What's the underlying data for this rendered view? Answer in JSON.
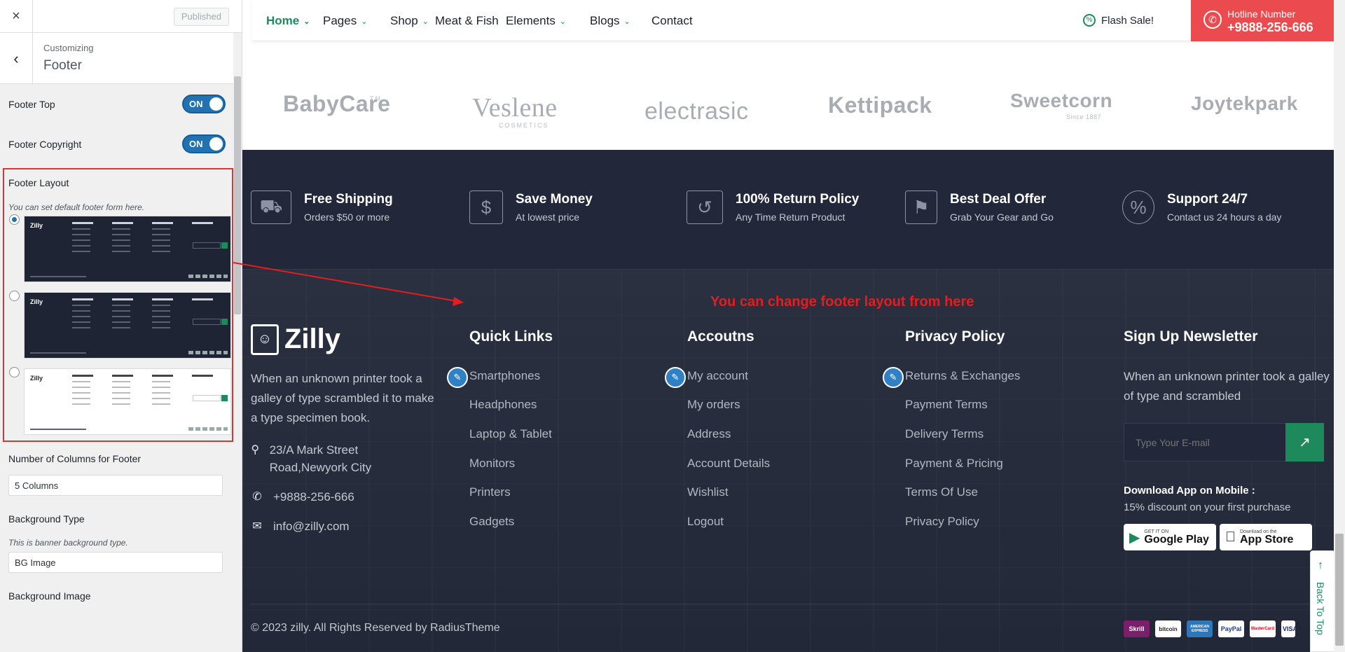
{
  "customizer": {
    "close_icon": "×",
    "published_label": "Published",
    "back_icon": "‹",
    "customizing_label": "Customizing",
    "section_title": "Footer",
    "footer_top_label": "Footer Top",
    "footer_top_toggle": "ON",
    "footer_copyright_label": "Footer Copyright",
    "footer_copyright_toggle": "ON",
    "footer_layout_label": "Footer Layout",
    "footer_layout_desc": "You can set default footer form here.",
    "layout_thumb_logo": "Zilly",
    "columns_label": "Number of Columns for Footer",
    "columns_value": "5 Columns",
    "bg_type_label": "Background Type",
    "bg_type_desc": "This is banner background type.",
    "bg_type_value": "BG Image",
    "bg_image_label": "Background Image"
  },
  "nav": {
    "items": [
      {
        "label": "Home",
        "has_dropdown": true,
        "active": true
      },
      {
        "label": "Pages",
        "has_dropdown": true
      },
      {
        "label": "Shop",
        "has_dropdown": true
      },
      {
        "label": "Meat & Fish",
        "has_dropdown": false
      },
      {
        "label": "Elements",
        "has_dropdown": true
      },
      {
        "label": "Blogs",
        "has_dropdown": true
      },
      {
        "label": "Contact",
        "has_dropdown": false
      }
    ],
    "flash_sale": "Flash Sale!",
    "hotline_label": "Hotline Number",
    "hotline_number": "+9888-256-666"
  },
  "brands": [
    {
      "name": "BabyCare",
      "mark": "TM"
    },
    {
      "name": "Veslene",
      "sub": "COSMETICS"
    },
    {
      "name": "electrasic"
    },
    {
      "name": "Kettipack"
    },
    {
      "name": "Sweetcorn",
      "sub": "Since 1887"
    },
    {
      "name": "Joytekpark"
    }
  ],
  "features": [
    {
      "title": "Free Shipping",
      "sub": "Orders $50 or more",
      "icon": "truck-icon"
    },
    {
      "title": "Save Money",
      "sub": "At lowest price",
      "icon": "money-hand-icon"
    },
    {
      "title": "100% Return Policy",
      "sub": "Any Time Return Product",
      "icon": "return-box-icon"
    },
    {
      "title": "Best Deal Offer",
      "sub": "Grab Your Gear and Go",
      "icon": "deal-tag-icon"
    },
    {
      "title": "Support 24/7",
      "sub": "Contact us 24 hours a day",
      "icon": "percent-badge-icon"
    }
  ],
  "annotation": "You can change footer layout from here",
  "footer": {
    "logo": "Zilly",
    "about": "When an unknown printer took a galley of type scrambled it to make a type specimen book.",
    "address": "23/A Mark Street Road,Newyork City",
    "phone": "+9888-256-666",
    "email": "info@zilly.com",
    "columns": [
      {
        "title": "Quick Links",
        "links": [
          "Smartphones",
          "Headphones",
          "Laptop & Tablet",
          "Monitors",
          "Printers",
          "Gadgets"
        ]
      },
      {
        "title": "Accoutns",
        "links": [
          "My account",
          "My orders",
          "Address",
          "Account Details",
          "Wishlist",
          "Logout"
        ]
      },
      {
        "title": "Privacy Policy",
        "links": [
          "Returns & Exchanges",
          "Payment Terms",
          "Delivery Terms",
          "Payment & Pricing",
          "Terms Of Use",
          "Privacy Policy"
        ]
      }
    ],
    "newsletter": {
      "title": "Sign Up Newsletter",
      "text": "When an unknown printer took a galley of type and scrambled",
      "placeholder": "Type Your E-mail",
      "app_heading": "Download App on Mobile :",
      "app_sub": "15% discount on your first purchase",
      "google_small": "GET IT ON",
      "google_big": "Google Play",
      "apple_small": "Download on the",
      "apple_big": "App Store"
    },
    "copyright": "© 2023 zilly. All Rights Reserved by RadiusTheme",
    "payments": [
      "Skrill",
      "bitcoin",
      "AMERICAN EXPRESS",
      "PayPal",
      "MasterCard",
      "VISA"
    ],
    "back_to_top": "Back To Top"
  },
  "colors": {
    "accent_green": "#1e8a5c",
    "hotline_red": "#eb4b4f",
    "footer_bg": "#22283a",
    "annotation_red": "#e51d1d",
    "toggle_blue": "#2271b1"
  }
}
